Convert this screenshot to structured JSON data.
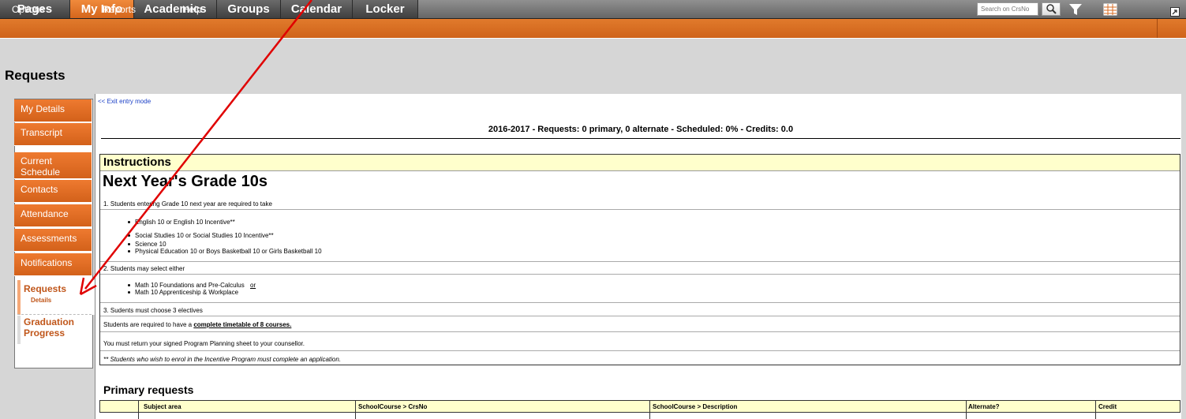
{
  "nav": {
    "tabs": [
      "Pages",
      "My Info",
      "Academics",
      "Groups",
      "Calendar",
      "Locker"
    ],
    "active_tab": "My Info"
  },
  "subnav": {
    "items": [
      "Options",
      "Reports",
      "Help"
    ],
    "search_placeholder": "Search on CrsNo"
  },
  "page": {
    "title": "Requests"
  },
  "sidebar": {
    "items": [
      {
        "label": "My Details"
      },
      {
        "label": "Transcript"
      },
      {
        "label": "Current Schedule"
      },
      {
        "label": "Contacts"
      },
      {
        "label": "Attendance"
      },
      {
        "label": "Assessments"
      },
      {
        "label": "Notifications"
      }
    ],
    "active": {
      "label": "Requests",
      "sublabel": "Details"
    },
    "extra": {
      "label": "Graduation Progress"
    }
  },
  "main": {
    "exit_link": "<< Exit entry mode",
    "summary": "2016-2017 - Requests: 0 primary, 0 alternate - Scheduled: 0% - Credits: 0.0",
    "instructions": {
      "title": "Instructions",
      "heading": "Next Year's Grade 10s",
      "step1": "1.  Students entering Grade 10 next year are required to take",
      "step1_items": [
        "English 10 or English 10 Incentive**",
        "Social Studies 10 or Social Studies 10 Incentive**",
        "Science 10",
        "Physical Education 10 or  Boys Basketball 10 or Girls Basketball 10"
      ],
      "step2": "2.  Students may select either",
      "step2_items": [
        "Math 10 Foundations and Pre-Calculus",
        "Math 10 Apprenticeship & Workplace"
      ],
      "step2_or": "or",
      "step3": "3.  Sudents must choose 3 electives",
      "timetable_prefix": "Students are required to have a",
      "timetable_bold": "complete timetable of 8 courses.",
      "return_note": "You must return your signed Program Planning sheet to your counsellor.",
      "incentive_note": "** Students who wish to enrol in the Incentive Program must complete an application."
    },
    "primary_requests": {
      "title": "Primary requests",
      "columns": [
        "Subject area",
        "SchoolCourse > CrsNo",
        "SchoolCourse > Description",
        "Alternate?",
        "Credit"
      ]
    }
  },
  "colors": {
    "accent": "#d96b22",
    "instructions_bg": "#ffffcc",
    "annotation_arrow": "#e00000"
  }
}
